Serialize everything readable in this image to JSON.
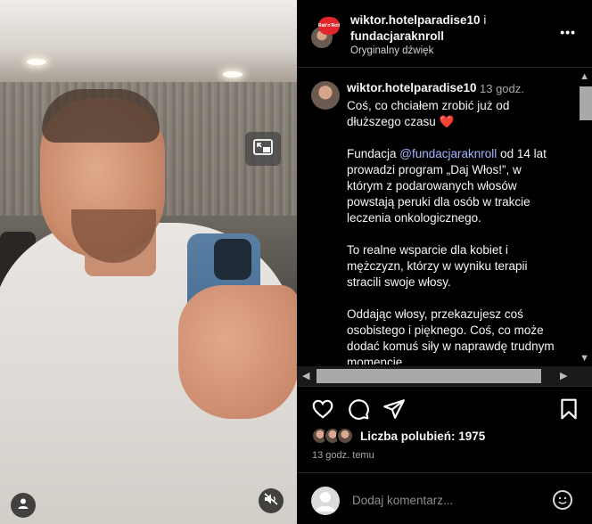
{
  "post": {
    "author_handle": "wiktor.hotelparadise10",
    "collab_separator": " i",
    "collab_handle": "fundacjaraknroll",
    "audio_label": "Oryginalny dźwięk",
    "badge_text": "Rak'n'Roll",
    "more_icon": "more-horizontal-icon"
  },
  "caption": {
    "author": "wiktor.hotelparadise10",
    "time": "13 godz.",
    "paragraph1": "Coś, co chciałem zrobić już od dłuższego czasu",
    "heart": "❤️",
    "p2_before": "Fundacja ",
    "p2_mention": "@fundacjaraknroll",
    "p2_after": " od 14 lat prowadzi program „Daj Włos!”, w którym z podarowanych włosów powstają peruki dla osób w trakcie leczenia onkologicznego.",
    "paragraph3": "To realne wsparcie dla kobiet i mężczyzn, którzy w wyniku terapii stracili swoje włosy.",
    "paragraph4": "Oddając włosy, przekazujesz coś osobistego i pięknego. Coś, co może dodać komuś siły w naprawdę trudnym momencie."
  },
  "actions": {
    "icons": [
      "heart-icon",
      "comment-icon",
      "share-icon",
      "bookmark-icon"
    ]
  },
  "likes": {
    "label": "Liczba polubień: 1975"
  },
  "timestamp": "13 godz. temu",
  "comment_input": {
    "placeholder": "Dodaj komentarz..."
  },
  "colors": {
    "background": "#000000",
    "mention": "#a3b7ff",
    "heart": "#e0262b",
    "muted": "#a8a8a8"
  }
}
